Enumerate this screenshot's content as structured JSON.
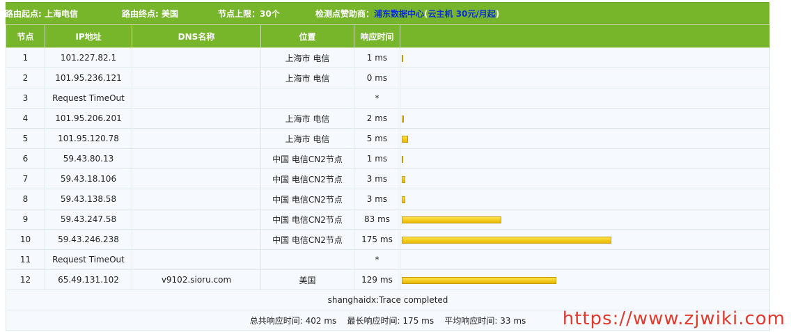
{
  "header": {
    "route_start": "路由起点: 上海电信",
    "route_end": "路由终点: 美国",
    "node_limit": "节点上限：30个",
    "sponsor_label": "检测点赞助商：",
    "sponsor_name": "浦东数据中心",
    "sponsor_open": "(",
    "sponsor_product": "云主机 30元/月起",
    "sponsor_close": ")"
  },
  "columns": [
    "节点",
    "IP地址",
    "DNS名称",
    "位置",
    "响应时间",
    ""
  ],
  "rows": [
    {
      "node": "1",
      "ip": "101.227.82.1",
      "dns": "",
      "loc": "上海市 电信",
      "time": "1 ms",
      "ms": 1
    },
    {
      "node": "2",
      "ip": "101.95.236.121",
      "dns": "",
      "loc": "上海市 电信",
      "time": "0 ms",
      "ms": 0
    },
    {
      "node": "3",
      "ip": "Request TimeOut",
      "dns": "",
      "loc": "",
      "time": "*",
      "ms": null
    },
    {
      "node": "4",
      "ip": "101.95.206.201",
      "dns": "",
      "loc": "上海市 电信",
      "time": "2 ms",
      "ms": 2
    },
    {
      "node": "5",
      "ip": "101.95.120.78",
      "dns": "",
      "loc": "上海市 电信",
      "time": "5 ms",
      "ms": 5
    },
    {
      "node": "6",
      "ip": "59.43.80.13",
      "dns": "",
      "loc": "中国 电信CN2节点",
      "time": "1 ms",
      "ms": 1
    },
    {
      "node": "7",
      "ip": "59.43.18.106",
      "dns": "",
      "loc": "中国 电信CN2节点",
      "time": "3 ms",
      "ms": 3
    },
    {
      "node": "8",
      "ip": "59.43.138.58",
      "dns": "",
      "loc": "中国 电信CN2节点",
      "time": "3 ms",
      "ms": 3
    },
    {
      "node": "9",
      "ip": "59.43.247.58",
      "dns": "",
      "loc": "中国 电信CN2节点",
      "time": "83 ms",
      "ms": 83
    },
    {
      "node": "10",
      "ip": "59.43.246.238",
      "dns": "",
      "loc": "中国 电信CN2节点",
      "time": "175 ms",
      "ms": 175
    },
    {
      "node": "11",
      "ip": "Request TimeOut",
      "dns": "",
      "loc": "",
      "time": "*",
      "ms": null
    },
    {
      "node": "12",
      "ip": "65.49.131.102",
      "dns": "v9102.sioru.com",
      "loc": "美国",
      "time": "129 ms",
      "ms": 129
    }
  ],
  "footer": {
    "status": "shanghaidx:Trace completed",
    "total_label": "总共响应时间:",
    "total_value": "402 ms",
    "max_label": "最长响应时间:",
    "max_value": "175 ms",
    "avg_label": "平均响应时间:",
    "avg_value": "33 ms"
  },
  "watermark": "https://www.zjwiki.com",
  "colors": {
    "header_bg": "#77b52b",
    "sponsor_link": "#0b2fd6",
    "bar": "#f2c800",
    "watermark": "#e03a2e"
  }
}
